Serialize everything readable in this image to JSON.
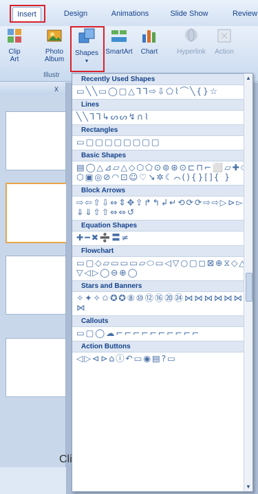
{
  "tabs": [
    "Insert",
    "Design",
    "Animations",
    "Slide Show",
    "Review"
  ],
  "ribbon": {
    "buttons": [
      {
        "label": "Clip\nArt"
      },
      {
        "label": "Photo\nAlbum"
      },
      {
        "label": "Shapes"
      },
      {
        "label": "SmartArt"
      },
      {
        "label": "Chart"
      },
      {
        "label": "Hyperlink"
      },
      {
        "label": "Action"
      }
    ],
    "group_label": "Illustr"
  },
  "slides_panel": {
    "close": "x"
  },
  "gallery": {
    "sections": [
      {
        "title": "Recently Used Shapes",
        "shapes": "▭╲╲▭◯▢△ᒣᒣ⇨⇩⬠⌇⌒╲{}☆"
      },
      {
        "title": "Lines",
        "shapes": "╲╲ᒣᒣ↳ᔕᔕ↯∩⌇"
      },
      {
        "title": "Rectangles",
        "shapes": "▭▢▢▢▢▢▢▢▢"
      },
      {
        "title": "Basic Shapes",
        "shapes": "▤◯△⊿▱△◇⬡⬠⊙⊚⊛⊙⊏⊓⌐⬜▱✚⬭⬡▣◎⊘◠⊡☺♡↘✲☾⌒(){}[]{ }"
      },
      {
        "title": "Block Arrows",
        "shapes": "⇨⇦⇧⇩⇔⇕✥⇪↱↰↲↵⟲⟳⟳⇨⇨▷⊳▻⇓⇓⇧⇧⇔⇔↺"
      },
      {
        "title": "Equation Shapes",
        "shapes": "✚━✖➗〓≠"
      },
      {
        "title": "Flowchart",
        "shapes": "▭▢◇▱▭▭▭▱⬭▭◁▽○▢◻⊠⊕⧖◇△▽◁▷◯⊖⊕◯"
      },
      {
        "title": "Stars and Banners",
        "shapes": "✧✦✧✩✪✪⑧⑩⑫⑯⑳㉔⋈⋈⋈⋈⋈⋈⋈"
      },
      {
        "title": "Callouts",
        "shapes": "▭▢◯☁⌐⌐⌐⌐⌐⌐⌐⌐⌐⌐"
      },
      {
        "title": "Action Buttons",
        "shapes": "◁▷⊲⊳⌂ⓘ↶▭◉▤?▭"
      }
    ]
  },
  "canvas": {
    "visible_text": "Cli"
  }
}
